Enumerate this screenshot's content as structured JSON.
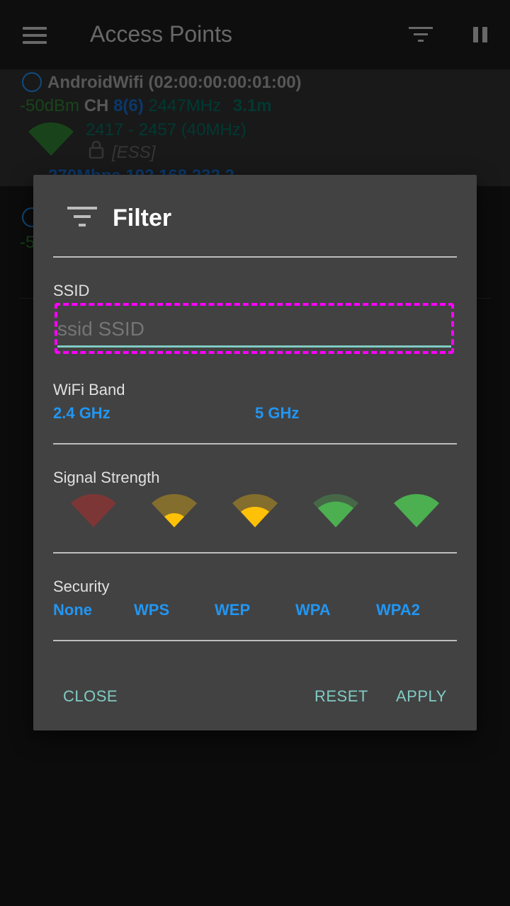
{
  "appbar": {
    "title": "Access Points",
    "icons": [
      "menu-icon",
      "filter-icon",
      "pause-icon"
    ]
  },
  "access_points": [
    {
      "ssid": "AndroidWifi (02:00:00:00:01:00)",
      "signal": "-50dBm",
      "ch_label": "CH",
      "channel": "8(6)",
      "frequency": "2447MHz",
      "distance": "3.1m",
      "range": "2417 - 2457 (40MHz)",
      "capabilities": "[ESS]",
      "extra": "270Mbps 192.168.232.2"
    },
    {
      "signal": "-5"
    }
  ],
  "dialog": {
    "title": "Filter",
    "ssid_label": "SSID",
    "ssid_placeholder": "ssid SSID",
    "wifi_band_label": "WiFi Band",
    "bands": [
      "2.4 GHz",
      "5 GHz"
    ],
    "signal_strength_label": "Signal Strength",
    "signal_levels": [
      {
        "level": 0,
        "color": "#c62828"
      },
      {
        "level": 1,
        "color": "#ffc107"
      },
      {
        "level": 2,
        "color": "#ffc107"
      },
      {
        "level": 3,
        "color": "#4caf50"
      },
      {
        "level": 4,
        "color": "#4caf50"
      }
    ],
    "security_label": "Security",
    "security_options": [
      "None",
      "WPS",
      "WEP",
      "WPA",
      "WPA2"
    ],
    "actions": {
      "close": "CLOSE",
      "reset": "RESET",
      "apply": "APPLY"
    }
  },
  "colors": {
    "accent": "#2196f3",
    "teal": "#80cbc4",
    "highlight": "#ff00ff"
  }
}
